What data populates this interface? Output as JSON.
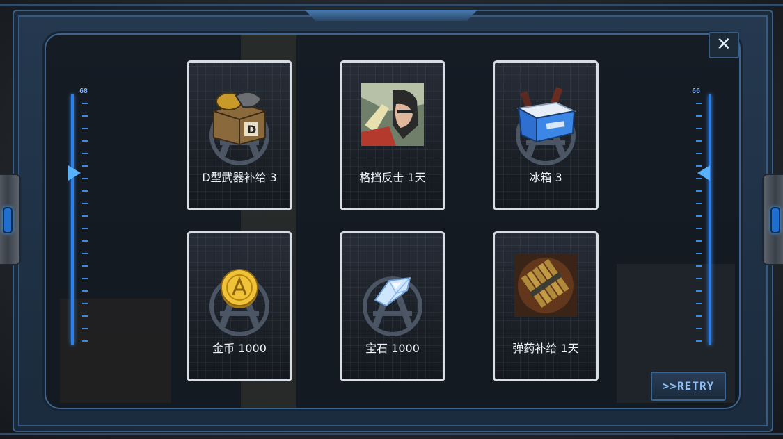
{
  "gauges": {
    "left_value": "68",
    "right_value": "66"
  },
  "close": {
    "label": "✕",
    "icon": "close-icon"
  },
  "rewards": [
    {
      "label": "D型武器补给 3",
      "icon": "weapon-crate-icon"
    },
    {
      "label": "格挡反击 1天",
      "icon": "block-counter-portrait-icon"
    },
    {
      "label": "冰箱 3",
      "icon": "cooler-box-icon"
    },
    {
      "label": "金币 1000",
      "icon": "gold-coin-icon"
    },
    {
      "label": "宝石 1000",
      "icon": "gem-icon"
    },
    {
      "label": "弹药补给 1天",
      "icon": "ammo-icon"
    }
  ],
  "retry": {
    "label": ">>RETRY"
  },
  "colors": {
    "accent": "#3d7fe0",
    "frame": "#3d5f86",
    "card_border": "#d8dde3"
  }
}
